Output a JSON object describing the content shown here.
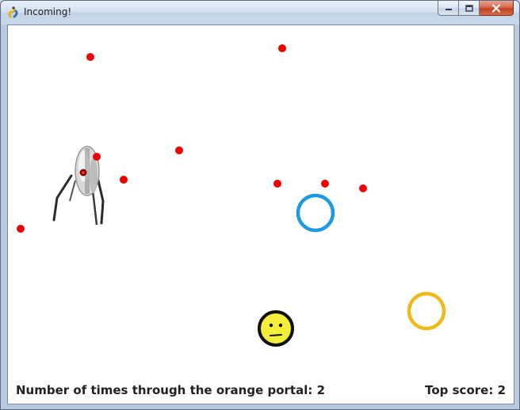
{
  "window": {
    "title": "Incoming!"
  },
  "hud": {
    "portal_count_label": "Number of times through the orange portal:",
    "portal_count": "2",
    "top_score_label": "Top score:",
    "top_score": "2"
  },
  "colors": {
    "projectile": "#ee0000",
    "blue_portal": "#1e9be0",
    "orange_portal": "#f0b91a",
    "player": "#f5ee3a"
  },
  "sprites": {
    "player": "smiley-face-icon",
    "enemy": "turret-icon"
  }
}
